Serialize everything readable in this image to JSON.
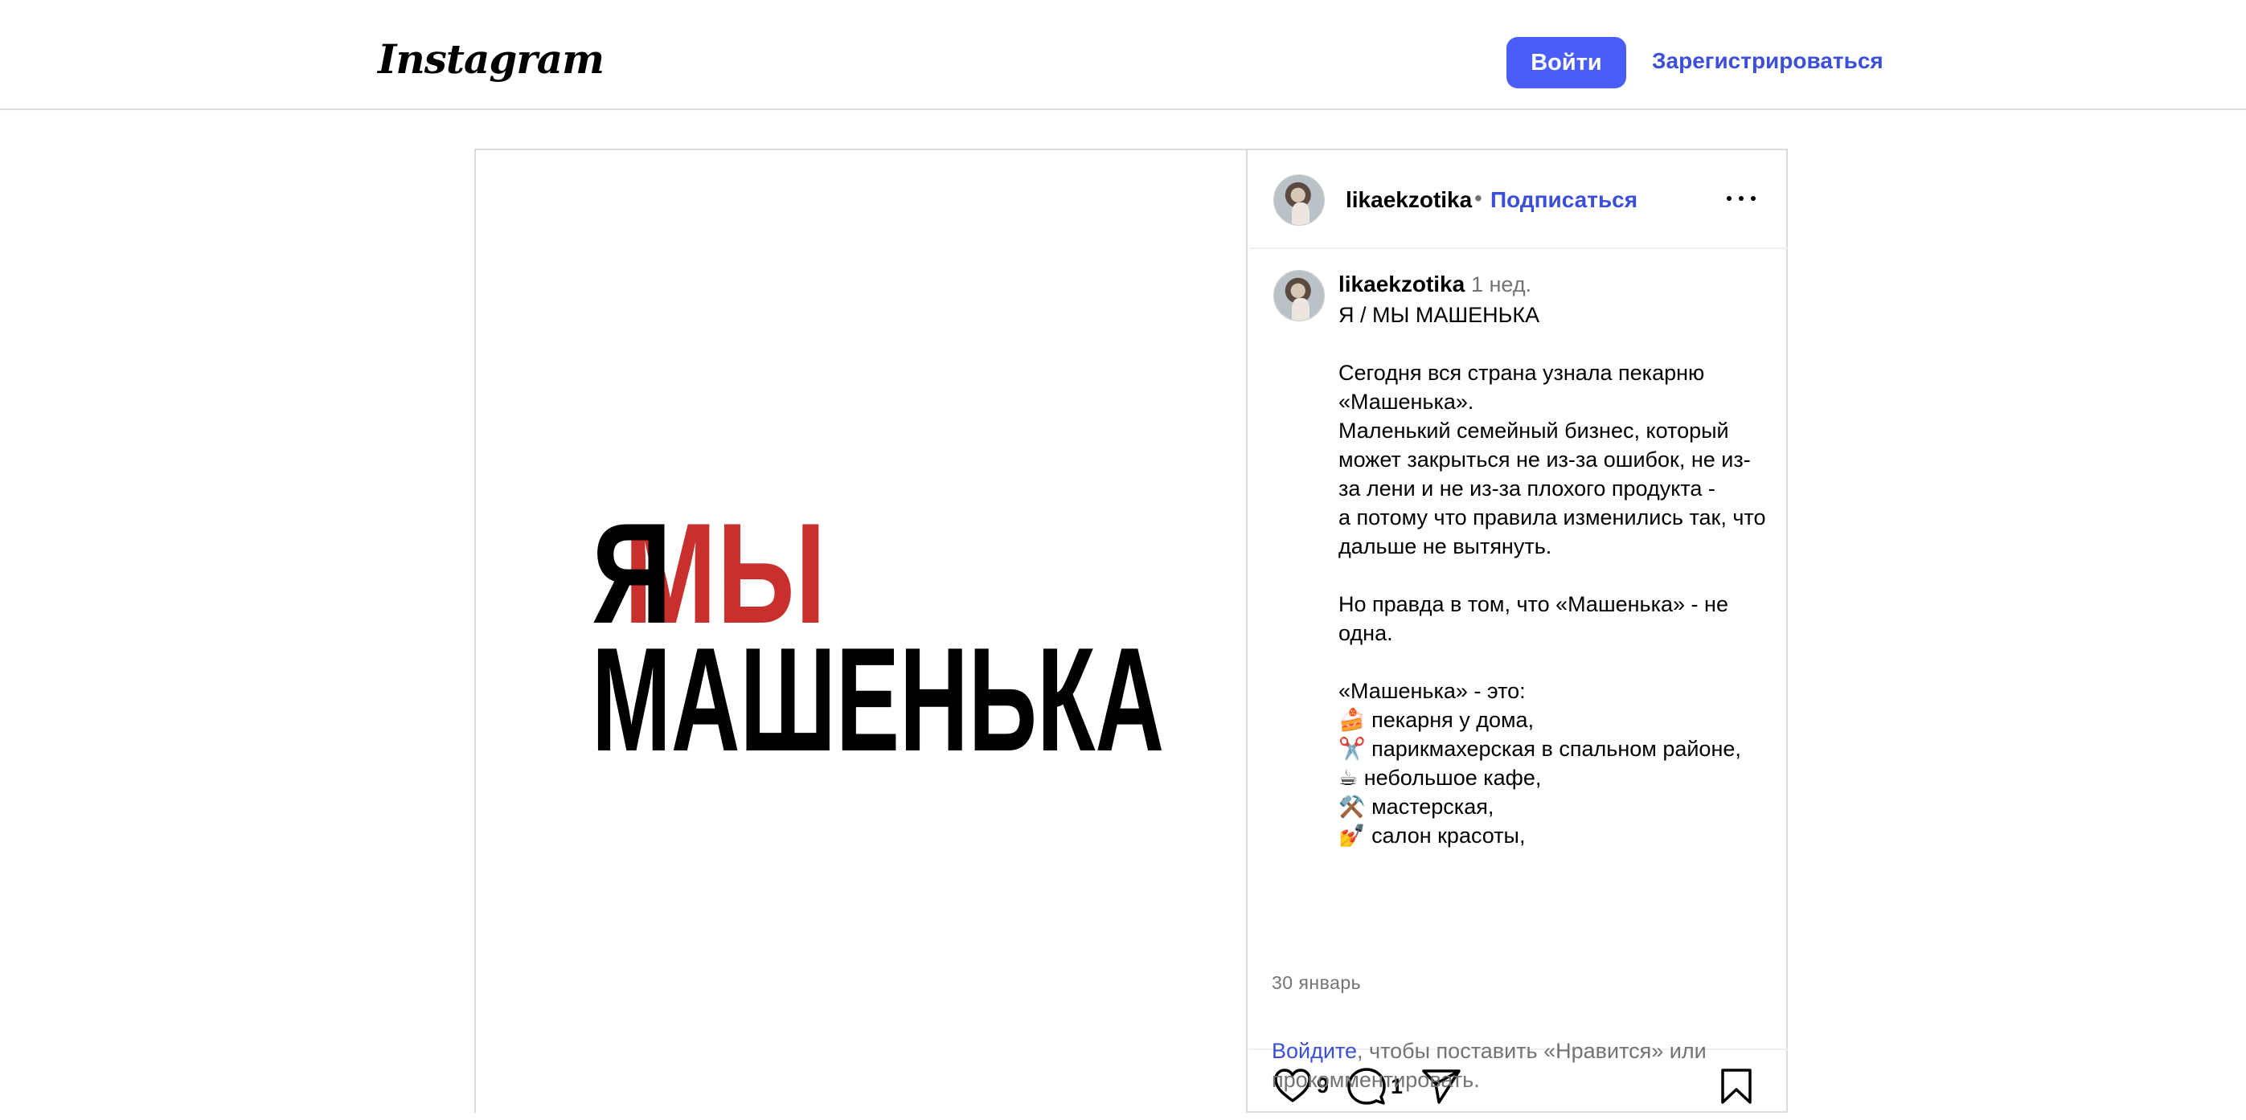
{
  "header": {
    "logo_text": "Instagram",
    "login_label": "Войти",
    "signup_label": "Зарегистрироваться"
  },
  "post": {
    "image": {
      "line1_black": "Я",
      "line1_red": "МЫ",
      "line2": "МАШЕНЬКА",
      "accent_color": "#c8302e"
    },
    "author": {
      "username": "likaekzotika",
      "separator": "•",
      "follow_label": "Подписаться"
    },
    "caption": {
      "username": "likaekzotika",
      "time": "1 нед.",
      "text": "Я / МЫ МАШЕНЬКА\n\nСегодня вся страна узнала пекарню «Машенька».\nМаленький семейный бизнес, который может закрыться не из-за ошибок, не из-за лени и не из-за плохого продукта -\nа потому что правила изменились так, что дальше не вытянуть.\n\nНо правда в том, что «Машенька» - не одна.\n\n«Машенька» - это:\n🍰 пекарня у дома,\n✂️ парикмахерская в спальном районе,\n☕ небольшое кафе,\n⚒️ мастерская,\n💅 салон красоты,"
    },
    "actions": {
      "like_count": "9",
      "comment_count": "1"
    },
    "date": "30 январь",
    "login_prompt": {
      "link": "Войдите",
      "rest": ", чтобы поставить «Нравится» или прокомментировать."
    }
  },
  "colors": {
    "brand_blue": "#4a5df9",
    "link_blue": "#3b4fd8",
    "muted_text": "#737373",
    "border": "#dbdbdb"
  }
}
